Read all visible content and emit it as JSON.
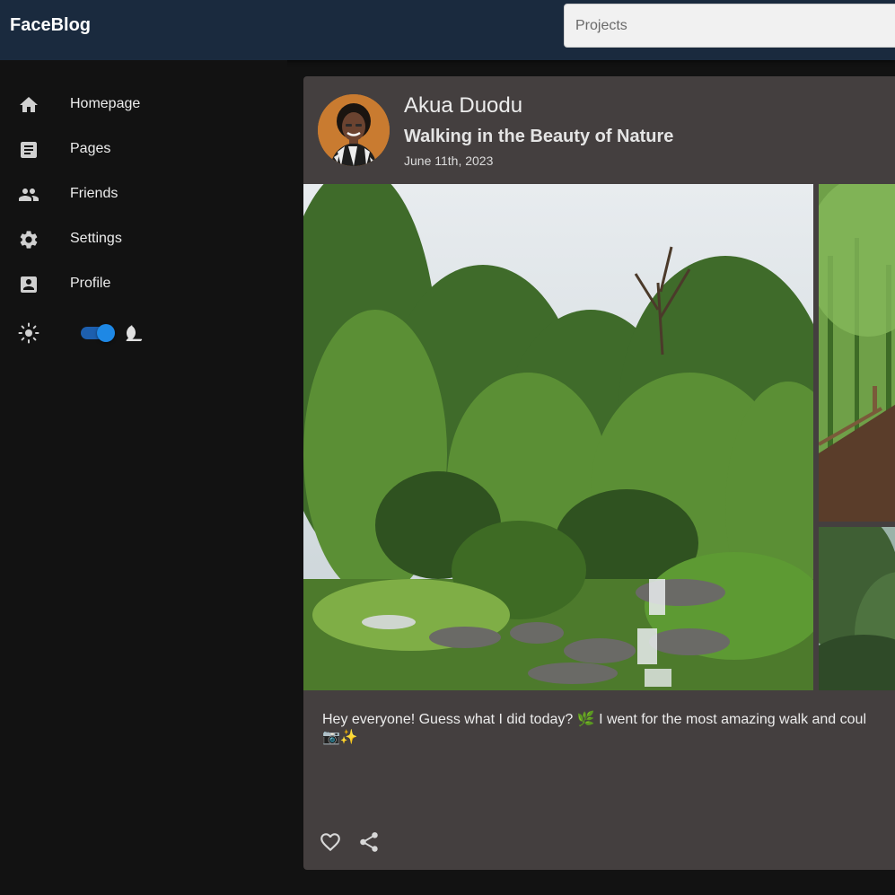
{
  "app": {
    "brand": "FaceBlog"
  },
  "search": {
    "placeholder": "Projects"
  },
  "sidebar": {
    "items": [
      {
        "label": "Homepage",
        "icon": "home-icon"
      },
      {
        "label": "Pages",
        "icon": "article-icon"
      },
      {
        "label": "Friends",
        "icon": "people-icon"
      },
      {
        "label": "Settings",
        "icon": "gear-icon"
      },
      {
        "label": "Profile",
        "icon": "account-box-icon"
      }
    ],
    "theme": {
      "light_icon": "sun-icon",
      "dark_icon": "moon-icon",
      "dark_mode_enabled": true
    }
  },
  "post": {
    "author": "Akua Duodu",
    "title": "Walking in the Beauty of Nature",
    "date": "June 11th, 2023",
    "body": "Hey everyone! Guess what I did today? 🌿 I went for the most amazing walk and coul",
    "body_line2": "📷✨",
    "actions": {
      "like_icon": "heart-icon",
      "share_icon": "share-icon"
    }
  },
  "colors": {
    "topbar": "#1a2a3e",
    "background": "#121212",
    "card": "#443f3f",
    "accent": "#1e88e5"
  }
}
